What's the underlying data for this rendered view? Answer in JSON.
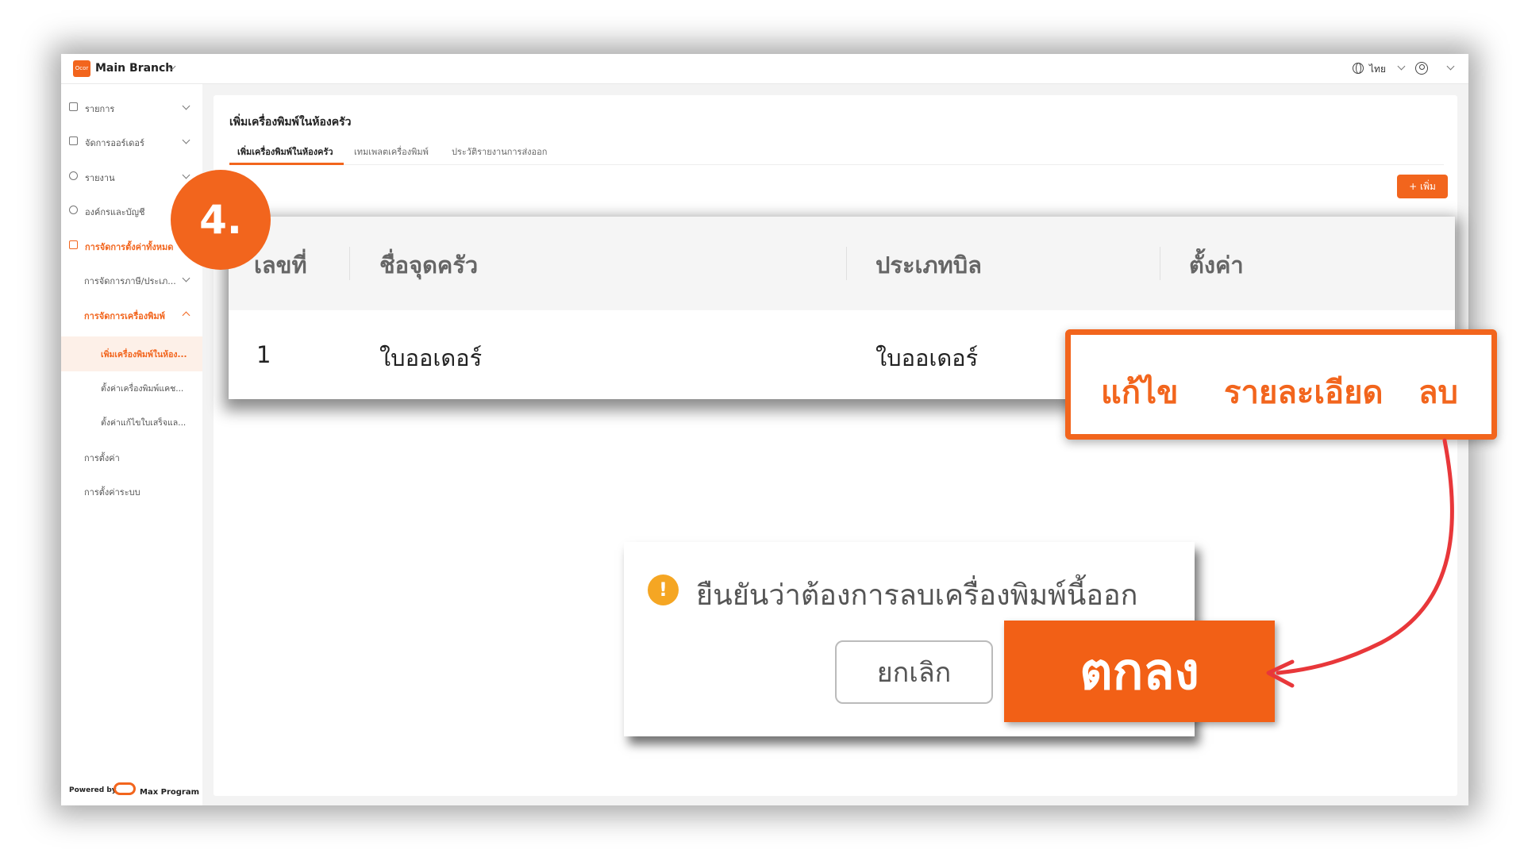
{
  "app": {
    "branch_name": "Main Branch",
    "logo_text": "Ocor",
    "language": "ไทย"
  },
  "sidebar": {
    "items": [
      {
        "label": "รายการ"
      },
      {
        "label": "จัดการออร์เดอร์"
      },
      {
        "label": "รายงาน"
      },
      {
        "label": "องค์กรและบัญชี"
      },
      {
        "label": "การจัดการตั้งค่าทั้งหมด"
      },
      {
        "label": "การจัดการภาษี/ประเภ..."
      },
      {
        "label": "การจัดการเครื่องพิมพ์"
      },
      {
        "label": "เพิ่มเครื่องพิมพ์ในห้อง..."
      },
      {
        "label": "ตั้งค่าเครื่องพิมพ์แคช..."
      },
      {
        "label": "ตั้งค่าแก้ไขใบเสร็จแล..."
      },
      {
        "label": "การตั้งค่า"
      },
      {
        "label": "การตั้งค่าระบบ"
      }
    ],
    "powered_by": "Powered by",
    "brand": "Max Program"
  },
  "page": {
    "title": "เพิ่มเครื่องพิมพ์ในห้องครัว",
    "tabs": [
      {
        "label": "เพิ่มเครื่องพิมพ์ในห้องครัว"
      },
      {
        "label": "เทมเพลตเครื่องพิมพ์"
      },
      {
        "label": "ประวัติรายงานการส่งออก"
      }
    ],
    "add_label": "+ เพิ่ม"
  },
  "table": {
    "headers": [
      "เลขที่",
      "ชื่อจุดครัว",
      "ประเภทบิล",
      "ตั้งค่า"
    ],
    "rows": [
      {
        "no": "1",
        "name": "ใบออเดอร์",
        "bill_type": "ใบออเดอร์"
      }
    ]
  },
  "step_badge": "4.",
  "callout": {
    "edit": "แก้ไข",
    "detail": "รายละเอียด",
    "delete": "ลบ"
  },
  "confirm": {
    "message": "ยืนยันว่าต้องการลบเครื่องพิมพ์นี้ออก",
    "cancel": "ยกเลิก",
    "ok": "ตกลง"
  },
  "colors": {
    "accent": "#f2651d",
    "warning": "#f5a623",
    "arrow": "#e8373a"
  }
}
